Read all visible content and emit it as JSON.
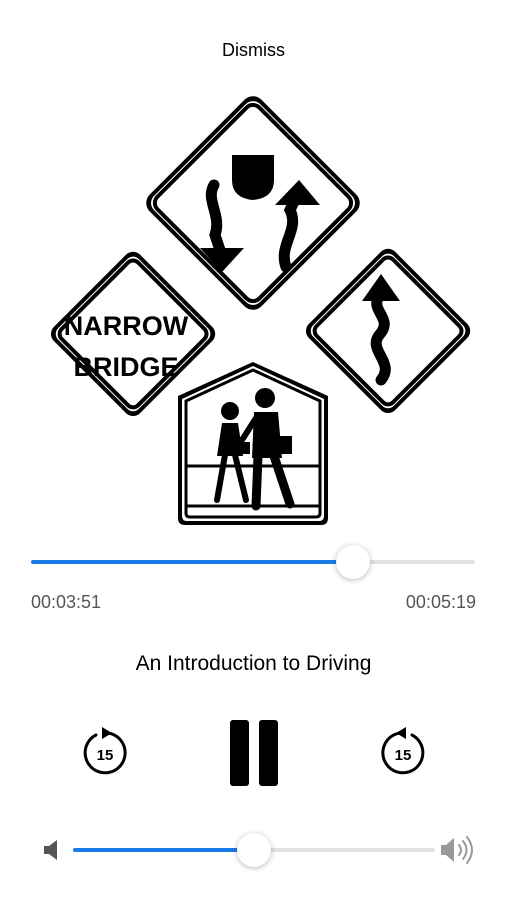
{
  "header": {
    "dismiss_label": "Dismiss"
  },
  "artwork": {
    "description_name": "road-signs-artwork",
    "sign_text_line1": "NARROW",
    "sign_text_line2": "BRIDGE"
  },
  "player": {
    "elapsed": "00:03:51",
    "total": "00:05:19",
    "progress_fraction": 0.7241,
    "track_title": "An Introduction to Driving",
    "skip_back_seconds": "15",
    "skip_forward_seconds": "15",
    "state": "playing"
  },
  "volume": {
    "level_fraction": 0.5
  },
  "colors": {
    "accent": "#1a7ae8",
    "track": "#e2e2e2",
    "thumb": "#ffffff",
    "text_secondary": "#555555"
  }
}
